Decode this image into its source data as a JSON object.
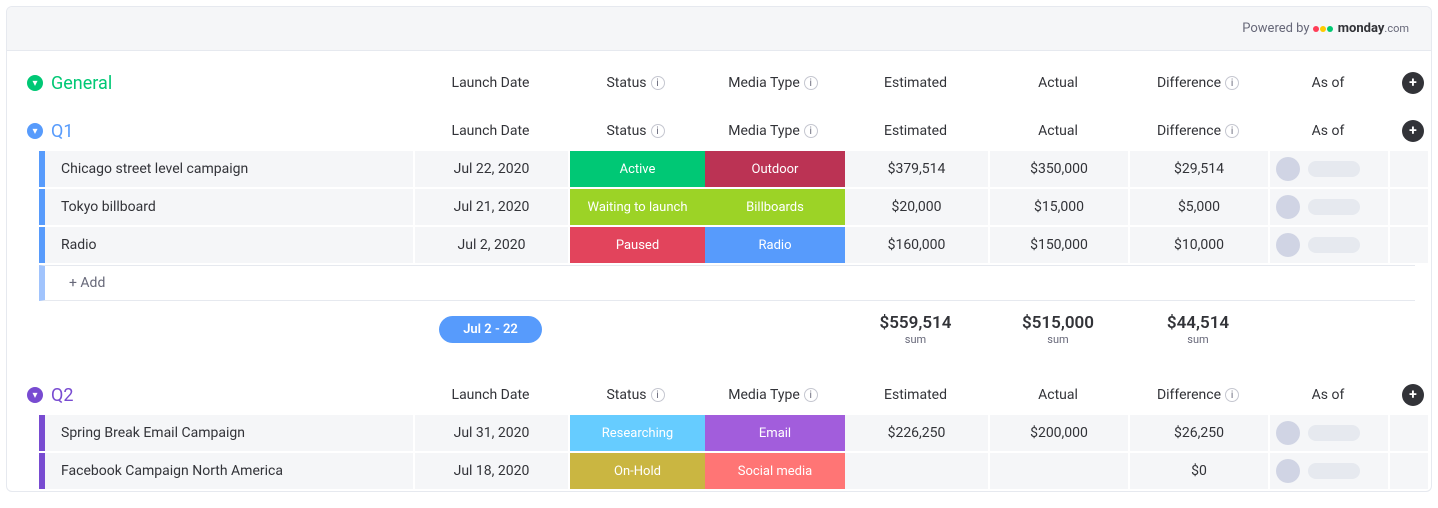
{
  "powered_by": {
    "label": "Powered by",
    "brand": "monday",
    "suffix": ".com"
  },
  "columns": {
    "launch_date": "Launch Date",
    "status": "Status",
    "media_type": "Media Type",
    "estimated": "Estimated",
    "actual": "Actual",
    "difference": "Difference",
    "as_of": "As of"
  },
  "add_row_label": "+ Add",
  "groups": {
    "general": {
      "title": "General",
      "color": "green"
    },
    "q1": {
      "title": "Q1",
      "color": "blue",
      "rows": [
        {
          "name": "Chicago street level campaign",
          "launch_date": "Jul 22, 2020",
          "status": {
            "label": "Active",
            "color": "#00c875"
          },
          "media": {
            "label": "Outdoor",
            "color": "#bb3354"
          },
          "estimated": "$379,514",
          "actual": "$350,000",
          "difference": "$29,514"
        },
        {
          "name": "Tokyo billboard",
          "launch_date": "Jul 21, 2020",
          "status": {
            "label": "Waiting to launch",
            "color": "#9cd326"
          },
          "media": {
            "label": "Billboards",
            "color": "#9cd326"
          },
          "estimated": "$20,000",
          "actual": "$15,000",
          "difference": "$5,000"
        },
        {
          "name": "Radio",
          "launch_date": "Jul 2, 2020",
          "status": {
            "label": "Paused",
            "color": "#e2445c"
          },
          "media": {
            "label": "Radio",
            "color": "#579bfc"
          },
          "estimated": "$160,000",
          "actual": "$150,000",
          "difference": "$10,000"
        }
      ],
      "summary": {
        "date_range": "Jul 2 - 22",
        "estimated": "$559,514",
        "actual": "$515,000",
        "difference": "$44,514",
        "label": "sum"
      }
    },
    "q2": {
      "title": "Q2",
      "color": "purple",
      "rows": [
        {
          "name": "Spring Break Email Campaign",
          "launch_date": "Jul 31, 2020",
          "status": {
            "label": "Researching",
            "color": "#66ccff"
          },
          "media": {
            "label": "Email",
            "color": "#a25ddc"
          },
          "estimated": "$226,250",
          "actual": "$200,000",
          "difference": "$26,250"
        },
        {
          "name": "Facebook Campaign North America",
          "launch_date": "Jul 18, 2020",
          "status": {
            "label": "On-Hold",
            "color": "#cab641"
          },
          "media": {
            "label": "Social media",
            "color": "#ff7575"
          },
          "estimated": "",
          "actual": "",
          "difference": "$0"
        }
      ]
    }
  }
}
